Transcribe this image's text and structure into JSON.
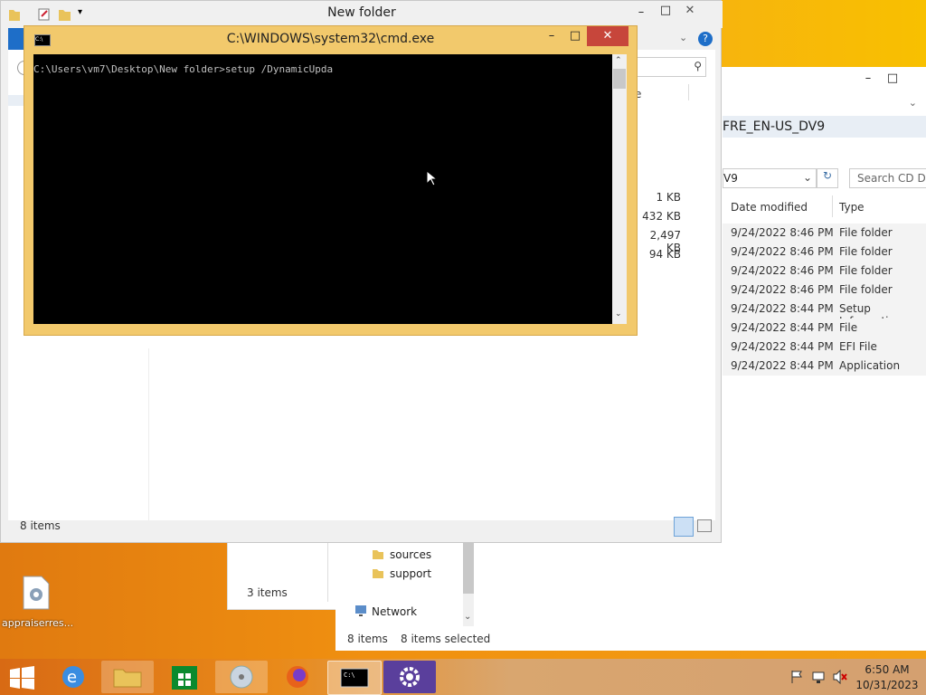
{
  "cmd": {
    "title": "C:\\WINDOWS\\system32\\cmd.exe",
    "line": "C:\\Users\\vm7\\Desktop\\New folder>setup /DynamicUpda"
  },
  "explorer_main": {
    "title": "New folder",
    "status": "8 items",
    "sizes": [
      "1 KB",
      "432 KB",
      "2,497 KB",
      "94 KB"
    ],
    "col_fragment": "e"
  },
  "explorer_right": {
    "path": "FRE_EN-US_DV9",
    "address": "V9",
    "search_placeholder": "Search CD Drive",
    "columns": [
      "Date modified",
      "Type"
    ],
    "rows": [
      {
        "date": "9/24/2022 8:46 PM",
        "type": "File folder"
      },
      {
        "date": "9/24/2022 8:46 PM",
        "type": "File folder"
      },
      {
        "date": "9/24/2022 8:46 PM",
        "type": "File folder"
      },
      {
        "date": "9/24/2022 8:46 PM",
        "type": "File folder"
      },
      {
        "date": "9/24/2022 8:44 PM",
        "type": "Setup Information"
      },
      {
        "date": "9/24/2022 8:44 PM",
        "type": "File"
      },
      {
        "date": "9/24/2022 8:44 PM",
        "type": "EFI File"
      },
      {
        "date": "9/24/2022 8:44 PM",
        "type": "Application"
      }
    ],
    "status_items": "8 items",
    "status_selected": "8 items selected"
  },
  "nav_pane": {
    "items": [
      "sources",
      "support"
    ],
    "network": "Network"
  },
  "left_window": {
    "status": "3 items"
  },
  "desktop": {
    "icon_label": "appraiserres..."
  },
  "clock": {
    "time": "6:50 AM",
    "date": "10/31/2023"
  },
  "colors": {
    "accent": "#f2c96c",
    "close": "#c7463b",
    "desktop": "#f0a000"
  }
}
